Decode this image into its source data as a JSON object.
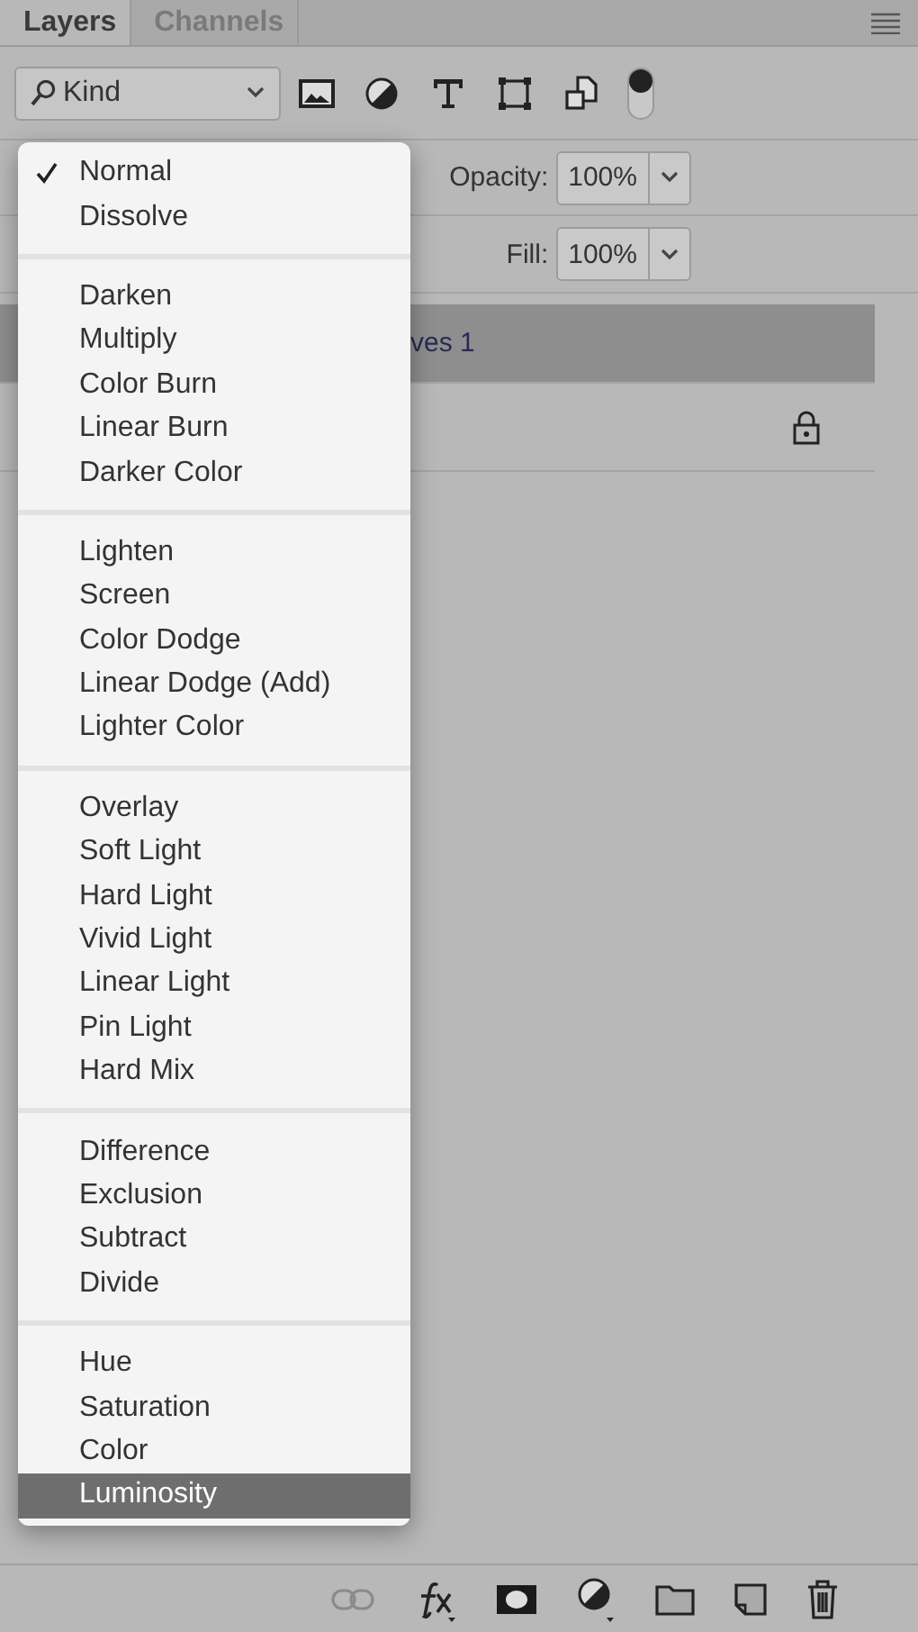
{
  "tabs": [
    {
      "label": "Layers",
      "selected": true
    },
    {
      "label": "Channels",
      "selected": false
    }
  ],
  "filter": {
    "value": "Kind"
  },
  "opacity": {
    "label": "Opacity:",
    "value": "100%"
  },
  "fill": {
    "label": "Fill:",
    "value": "100%"
  },
  "layers": [
    {
      "name": "ves 1",
      "selected": true,
      "locked": false
    },
    {
      "selected": false,
      "locked": true
    }
  ],
  "blend_menu": [
    {
      "items": [
        {
          "label": "Normal",
          "checked": true,
          "selected": false
        },
        {
          "label": "Dissolve",
          "checked": false,
          "selected": false
        }
      ]
    },
    {
      "items": [
        {
          "label": "Darken",
          "checked": false,
          "selected": false
        },
        {
          "label": "Multiply",
          "checked": false,
          "selected": false
        },
        {
          "label": "Color Burn",
          "checked": false,
          "selected": false
        },
        {
          "label": "Linear Burn",
          "checked": false,
          "selected": false
        },
        {
          "label": "Darker Color",
          "checked": false,
          "selected": false
        }
      ]
    },
    {
      "items": [
        {
          "label": "Lighten",
          "checked": false,
          "selected": false
        },
        {
          "label": "Screen",
          "checked": false,
          "selected": false
        },
        {
          "label": "Color Dodge",
          "checked": false,
          "selected": false
        },
        {
          "label": "Linear Dodge (Add)",
          "checked": false,
          "selected": false
        },
        {
          "label": "Lighter Color",
          "checked": false,
          "selected": false
        }
      ]
    },
    {
      "items": [
        {
          "label": "Overlay",
          "checked": false,
          "selected": false
        },
        {
          "label": "Soft Light",
          "checked": false,
          "selected": false
        },
        {
          "label": "Hard Light",
          "checked": false,
          "selected": false
        },
        {
          "label": "Vivid Light",
          "checked": false,
          "selected": false
        },
        {
          "label": "Linear Light",
          "checked": false,
          "selected": false
        },
        {
          "label": "Pin Light",
          "checked": false,
          "selected": false
        },
        {
          "label": "Hard Mix",
          "checked": false,
          "selected": false
        }
      ]
    },
    {
      "items": [
        {
          "label": "Difference",
          "checked": false,
          "selected": false
        },
        {
          "label": "Exclusion",
          "checked": false,
          "selected": false
        },
        {
          "label": "Subtract",
          "checked": false,
          "selected": false
        },
        {
          "label": "Divide",
          "checked": false,
          "selected": false
        }
      ]
    },
    {
      "items": [
        {
          "label": "Hue",
          "checked": false,
          "selected": false
        },
        {
          "label": "Saturation",
          "checked": false,
          "selected": false
        },
        {
          "label": "Color",
          "checked": false,
          "selected": false
        },
        {
          "label": "Luminosity",
          "checked": false,
          "selected": true
        }
      ]
    }
  ]
}
